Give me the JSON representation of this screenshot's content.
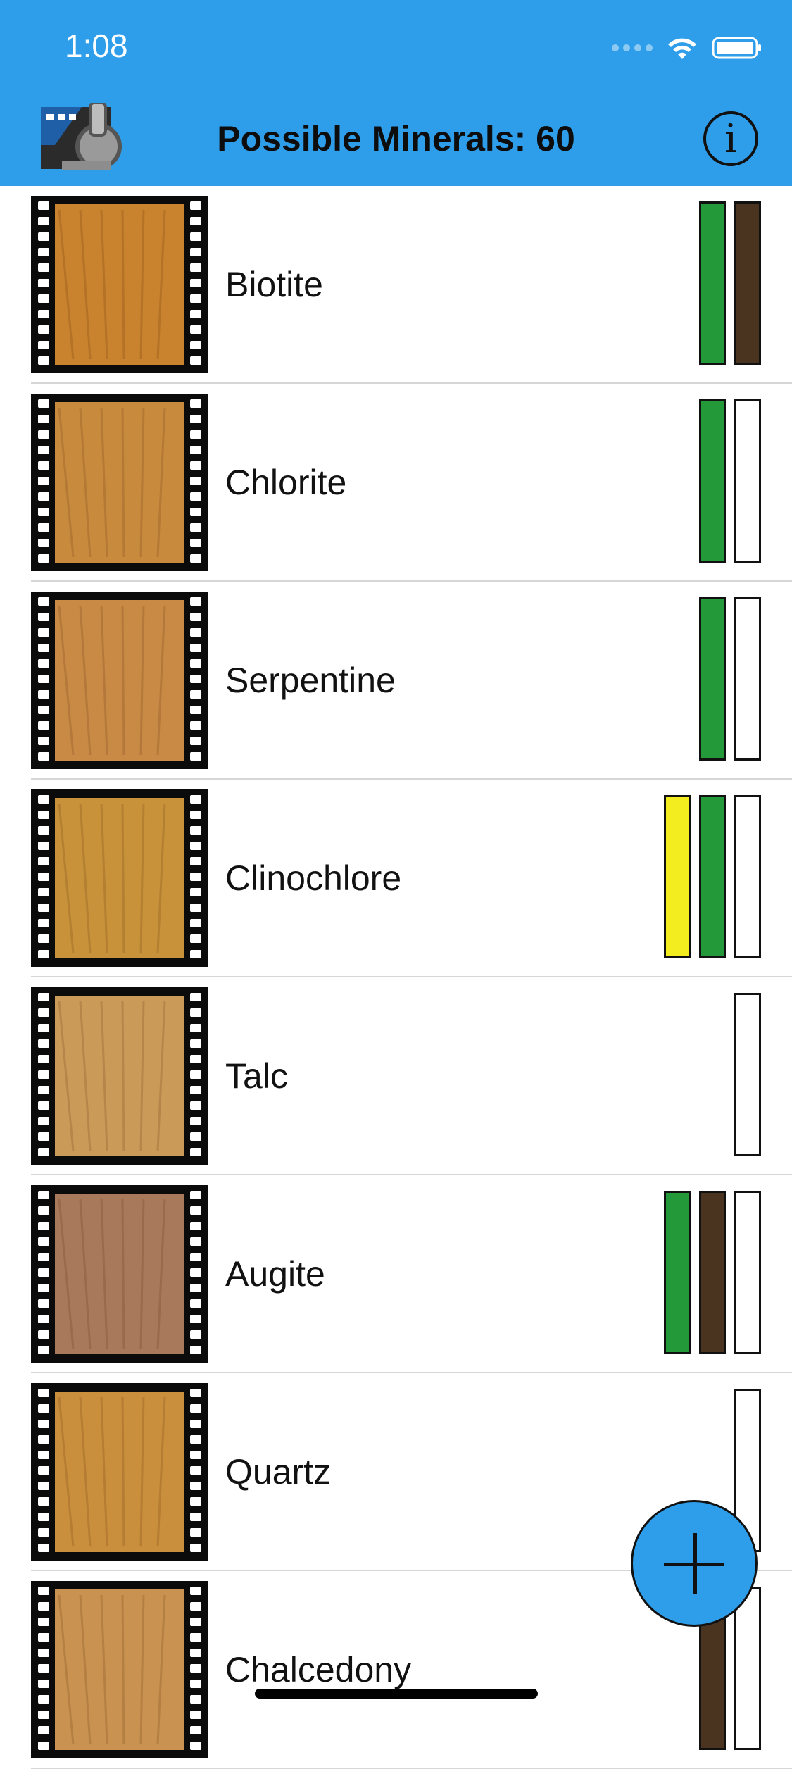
{
  "status_bar": {
    "time": "1:08"
  },
  "header": {
    "title": "Possible Minerals: 60",
    "info_label": "i"
  },
  "minerals": [
    {
      "name": "Biotite",
      "tone": "#c9822e",
      "indicators": [
        "green",
        "brown"
      ]
    },
    {
      "name": "Chlorite",
      "tone": "#c88a3d",
      "indicators": [
        "green",
        "white"
      ]
    },
    {
      "name": "Serpentine",
      "tone": "#c98a45",
      "indicators": [
        "green",
        "white"
      ]
    },
    {
      "name": "Clinochlore",
      "tone": "#c7923a",
      "indicators": [
        "yellow",
        "green",
        "white"
      ]
    },
    {
      "name": "Talc",
      "tone": "#c99a58",
      "indicators": [
        "white"
      ]
    },
    {
      "name": "Augite",
      "tone": "#a8795a",
      "indicators": [
        "green",
        "brown",
        "white"
      ]
    },
    {
      "name": "Quartz",
      "tone": "#c98f3c",
      "indicators": [
        "white"
      ]
    },
    {
      "name": "Chalcedony",
      "tone": "#c99250",
      "indicators": [
        "brown",
        "white"
      ]
    }
  ],
  "fab": {
    "icon": "plus-icon"
  },
  "colors": {
    "header": "#2f9eea",
    "green": "#23993a",
    "brown": "#4a331f",
    "yellow": "#f3ec1f"
  }
}
